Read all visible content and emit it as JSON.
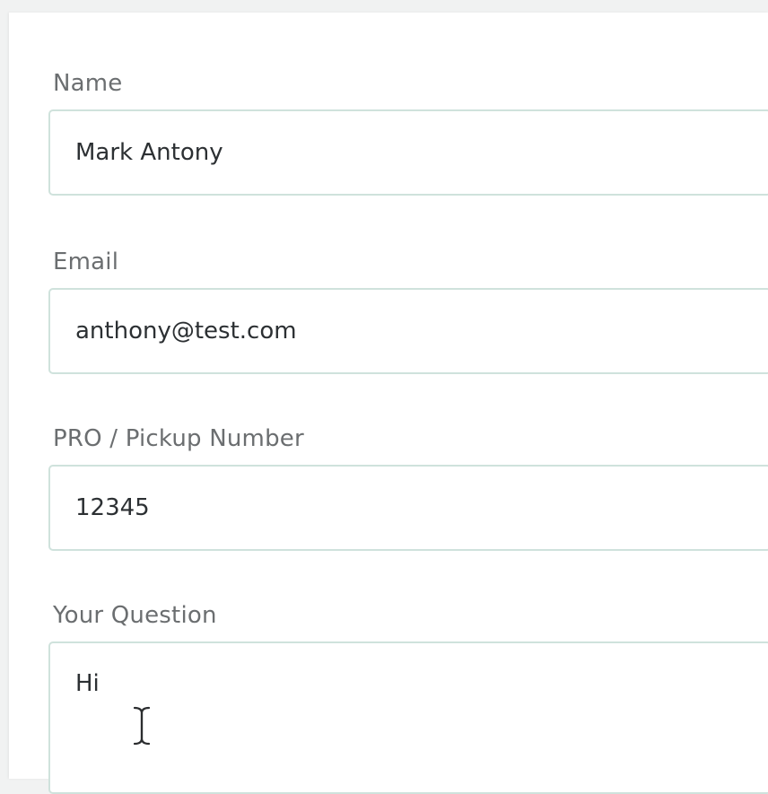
{
  "form": {
    "name": {
      "label": "Name",
      "value": "Mark Antony"
    },
    "email": {
      "label": "Email",
      "value": "anthony@test.com"
    },
    "pro_number": {
      "label": "PRO / Pickup Number",
      "value": "12345"
    },
    "question": {
      "label": "Your Question",
      "value": "Hi"
    }
  },
  "cursor": {
    "icon": "text-cursor-icon"
  },
  "colors": {
    "background": "#f1f2f2",
    "panel": "#ffffff",
    "label_text": "#6b6e70",
    "input_text": "#2c3033",
    "input_border": "#cfe2dc"
  }
}
